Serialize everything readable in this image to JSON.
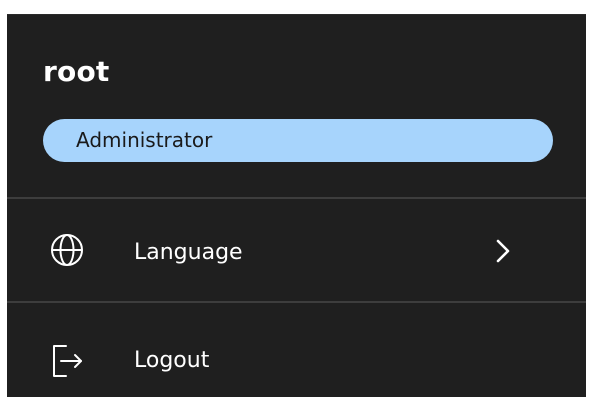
{
  "user": {
    "name": "root",
    "role": "Administrator"
  },
  "menu": {
    "items": [
      {
        "label": "Language",
        "icon": "globe-icon",
        "has_submenu": true
      },
      {
        "label": "Logout",
        "icon": "logout-icon",
        "has_submenu": false
      }
    ]
  },
  "colors": {
    "background": "#1f1f1f",
    "badge": "#a7d4fc",
    "divider": "#3d3d3d",
    "text": "#ffffff"
  }
}
